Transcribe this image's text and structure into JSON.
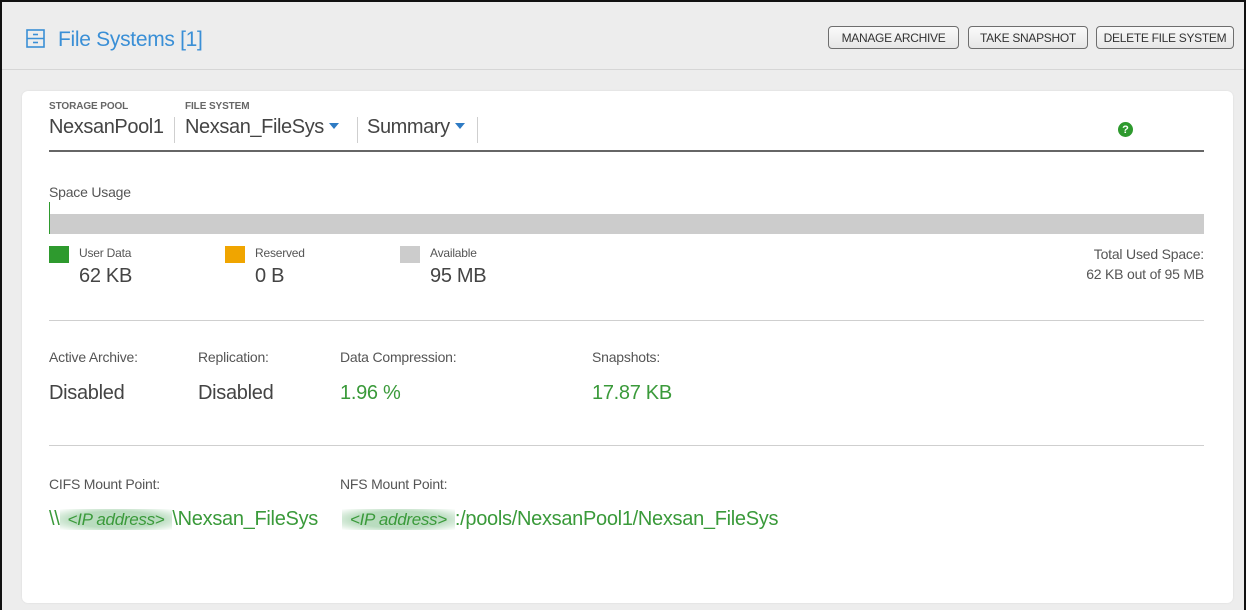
{
  "header": {
    "title": "File Systems [1]",
    "icon": "file-cabinet-icon",
    "buttons": {
      "manage_archive": "MANAGE ARCHIVE",
      "take_snapshot": "TAKE SNAPSHOT",
      "delete_file_system": "DELETE FILE SYSTEM"
    }
  },
  "breadcrumb": {
    "storage_pool": {
      "label": "STORAGE POOL",
      "value": "NexsanPool1"
    },
    "file_system": {
      "label": "FILE SYSTEM",
      "value": "Nexsan_FileSys"
    },
    "view": {
      "value": "Summary"
    }
  },
  "help_icon": "?",
  "space_usage": {
    "title": "Space Usage",
    "user_data_fraction": 0.0006,
    "legend": [
      {
        "name": "User Data",
        "value": "62 KB",
        "color": "#2e9a2e"
      },
      {
        "name": "Reserved",
        "value": "0 B",
        "color": "#f0a500"
      },
      {
        "name": "Available",
        "value": "95 MB",
        "color": "#cccccc"
      }
    ],
    "total_label": "Total Used Space:",
    "total_value": "62 KB out of 95 MB"
  },
  "stats": [
    {
      "label": "Active Archive:",
      "value": "Disabled"
    },
    {
      "label": "Replication:",
      "value": "Disabled"
    },
    {
      "label": "Data Compression:",
      "value": "1.96 %"
    },
    {
      "label": "Snapshots:",
      "value": "17.87 KB"
    }
  ],
  "mount_points": {
    "cifs": {
      "label": "CIFS Mount Point:",
      "prefix": "\\\\",
      "ip": "<IP address>",
      "suffix": "\\Nexsan_FileSys"
    },
    "nfs": {
      "label": "NFS Mount Point:",
      "ip": "<IP address>",
      "suffix": ":/pools/NexsanPool1/Nexsan_FileSys"
    }
  }
}
